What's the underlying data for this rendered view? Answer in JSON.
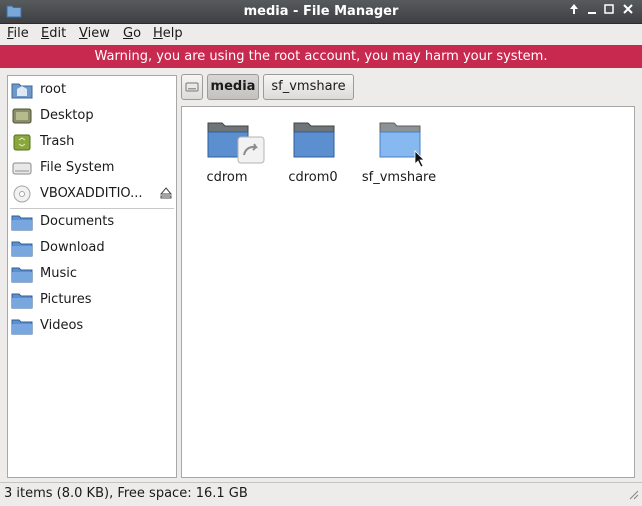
{
  "window": {
    "title": "media - File Manager"
  },
  "menu": [
    {
      "label_u": "F",
      "label_rest": "ile"
    },
    {
      "label_u": "E",
      "label_rest": "dit"
    },
    {
      "label_u": "V",
      "label_rest": "iew"
    },
    {
      "label_u": "G",
      "label_rest": "o"
    },
    {
      "label_u": "H",
      "label_rest": "elp"
    }
  ],
  "warning": "Warning, you are using the root account, you may harm your system.",
  "sidebar": {
    "places": [
      {
        "label": "root",
        "icon": "home-folder-icon"
      },
      {
        "label": "Desktop",
        "icon": "desktop-icon"
      },
      {
        "label": "Trash",
        "icon": "trash-icon"
      },
      {
        "label": "File System",
        "icon": "drive-icon"
      },
      {
        "label": "VBOXADDITIO...",
        "icon": "optical-disc-icon"
      }
    ],
    "bookmarks": [
      {
        "label": "Documents",
        "icon": "folder-icon"
      },
      {
        "label": "Download",
        "icon": "folder-icon"
      },
      {
        "label": "Music",
        "icon": "folder-icon"
      },
      {
        "label": "Pictures",
        "icon": "folder-icon"
      },
      {
        "label": "Videos",
        "icon": "folder-icon"
      }
    ]
  },
  "pathbar": {
    "current": "media",
    "next": "sf_vmshare"
  },
  "files": [
    {
      "name": "cdrom",
      "icon": "folder-link-icon"
    },
    {
      "name": "cdrom0",
      "icon": "folder-icon"
    },
    {
      "name": "sf_vmshare",
      "icon": "folder-icon"
    }
  ],
  "status": "3 items (8.0 KB), Free space: 16.1 GB",
  "colors": {
    "warning_bg": "#c8294e",
    "folder_blue": "#4f86c6"
  }
}
